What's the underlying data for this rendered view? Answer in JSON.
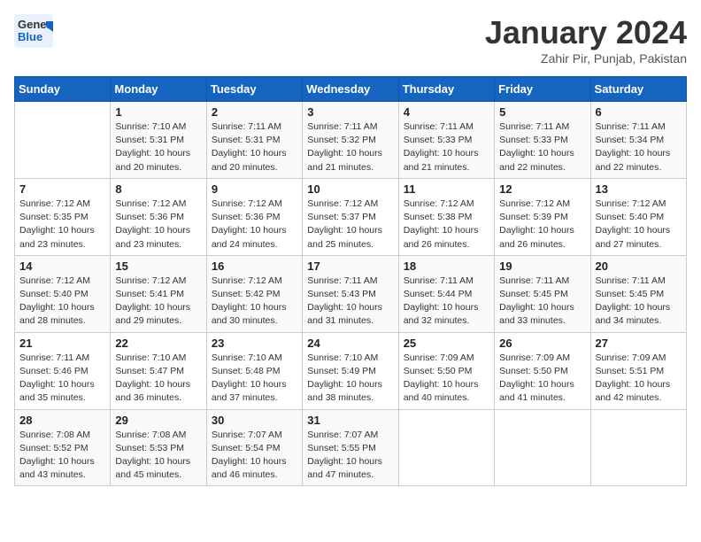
{
  "header": {
    "logo_general": "General",
    "logo_blue": "Blue",
    "title": "January 2024",
    "subtitle": "Zahir Pir, Punjab, Pakistan"
  },
  "days_of_week": [
    "Sunday",
    "Monday",
    "Tuesday",
    "Wednesday",
    "Thursday",
    "Friday",
    "Saturday"
  ],
  "weeks": [
    [
      {
        "day": "",
        "sunrise": "",
        "sunset": "",
        "daylight": ""
      },
      {
        "day": "1",
        "sunrise": "Sunrise: 7:10 AM",
        "sunset": "Sunset: 5:31 PM",
        "daylight": "Daylight: 10 hours and 20 minutes."
      },
      {
        "day": "2",
        "sunrise": "Sunrise: 7:11 AM",
        "sunset": "Sunset: 5:31 PM",
        "daylight": "Daylight: 10 hours and 20 minutes."
      },
      {
        "day": "3",
        "sunrise": "Sunrise: 7:11 AM",
        "sunset": "Sunset: 5:32 PM",
        "daylight": "Daylight: 10 hours and 21 minutes."
      },
      {
        "day": "4",
        "sunrise": "Sunrise: 7:11 AM",
        "sunset": "Sunset: 5:33 PM",
        "daylight": "Daylight: 10 hours and 21 minutes."
      },
      {
        "day": "5",
        "sunrise": "Sunrise: 7:11 AM",
        "sunset": "Sunset: 5:33 PM",
        "daylight": "Daylight: 10 hours and 22 minutes."
      },
      {
        "day": "6",
        "sunrise": "Sunrise: 7:11 AM",
        "sunset": "Sunset: 5:34 PM",
        "daylight": "Daylight: 10 hours and 22 minutes."
      }
    ],
    [
      {
        "day": "7",
        "sunrise": "Sunrise: 7:12 AM",
        "sunset": "Sunset: 5:35 PM",
        "daylight": "Daylight: 10 hours and 23 minutes."
      },
      {
        "day": "8",
        "sunrise": "Sunrise: 7:12 AM",
        "sunset": "Sunset: 5:36 PM",
        "daylight": "Daylight: 10 hours and 23 minutes."
      },
      {
        "day": "9",
        "sunrise": "Sunrise: 7:12 AM",
        "sunset": "Sunset: 5:36 PM",
        "daylight": "Daylight: 10 hours and 24 minutes."
      },
      {
        "day": "10",
        "sunrise": "Sunrise: 7:12 AM",
        "sunset": "Sunset: 5:37 PM",
        "daylight": "Daylight: 10 hours and 25 minutes."
      },
      {
        "day": "11",
        "sunrise": "Sunrise: 7:12 AM",
        "sunset": "Sunset: 5:38 PM",
        "daylight": "Daylight: 10 hours and 26 minutes."
      },
      {
        "day": "12",
        "sunrise": "Sunrise: 7:12 AM",
        "sunset": "Sunset: 5:39 PM",
        "daylight": "Daylight: 10 hours and 26 minutes."
      },
      {
        "day": "13",
        "sunrise": "Sunrise: 7:12 AM",
        "sunset": "Sunset: 5:40 PM",
        "daylight": "Daylight: 10 hours and 27 minutes."
      }
    ],
    [
      {
        "day": "14",
        "sunrise": "Sunrise: 7:12 AM",
        "sunset": "Sunset: 5:40 PM",
        "daylight": "Daylight: 10 hours and 28 minutes."
      },
      {
        "day": "15",
        "sunrise": "Sunrise: 7:12 AM",
        "sunset": "Sunset: 5:41 PM",
        "daylight": "Daylight: 10 hours and 29 minutes."
      },
      {
        "day": "16",
        "sunrise": "Sunrise: 7:12 AM",
        "sunset": "Sunset: 5:42 PM",
        "daylight": "Daylight: 10 hours and 30 minutes."
      },
      {
        "day": "17",
        "sunrise": "Sunrise: 7:11 AM",
        "sunset": "Sunset: 5:43 PM",
        "daylight": "Daylight: 10 hours and 31 minutes."
      },
      {
        "day": "18",
        "sunrise": "Sunrise: 7:11 AM",
        "sunset": "Sunset: 5:44 PM",
        "daylight": "Daylight: 10 hours and 32 minutes."
      },
      {
        "day": "19",
        "sunrise": "Sunrise: 7:11 AM",
        "sunset": "Sunset: 5:45 PM",
        "daylight": "Daylight: 10 hours and 33 minutes."
      },
      {
        "day": "20",
        "sunrise": "Sunrise: 7:11 AM",
        "sunset": "Sunset: 5:45 PM",
        "daylight": "Daylight: 10 hours and 34 minutes."
      }
    ],
    [
      {
        "day": "21",
        "sunrise": "Sunrise: 7:11 AM",
        "sunset": "Sunset: 5:46 PM",
        "daylight": "Daylight: 10 hours and 35 minutes."
      },
      {
        "day": "22",
        "sunrise": "Sunrise: 7:10 AM",
        "sunset": "Sunset: 5:47 PM",
        "daylight": "Daylight: 10 hours and 36 minutes."
      },
      {
        "day": "23",
        "sunrise": "Sunrise: 7:10 AM",
        "sunset": "Sunset: 5:48 PM",
        "daylight": "Daylight: 10 hours and 37 minutes."
      },
      {
        "day": "24",
        "sunrise": "Sunrise: 7:10 AM",
        "sunset": "Sunset: 5:49 PM",
        "daylight": "Daylight: 10 hours and 38 minutes."
      },
      {
        "day": "25",
        "sunrise": "Sunrise: 7:09 AM",
        "sunset": "Sunset: 5:50 PM",
        "daylight": "Daylight: 10 hours and 40 minutes."
      },
      {
        "day": "26",
        "sunrise": "Sunrise: 7:09 AM",
        "sunset": "Sunset: 5:50 PM",
        "daylight": "Daylight: 10 hours and 41 minutes."
      },
      {
        "day": "27",
        "sunrise": "Sunrise: 7:09 AM",
        "sunset": "Sunset: 5:51 PM",
        "daylight": "Daylight: 10 hours and 42 minutes."
      }
    ],
    [
      {
        "day": "28",
        "sunrise": "Sunrise: 7:08 AM",
        "sunset": "Sunset: 5:52 PM",
        "daylight": "Daylight: 10 hours and 43 minutes."
      },
      {
        "day": "29",
        "sunrise": "Sunrise: 7:08 AM",
        "sunset": "Sunset: 5:53 PM",
        "daylight": "Daylight: 10 hours and 45 minutes."
      },
      {
        "day": "30",
        "sunrise": "Sunrise: 7:07 AM",
        "sunset": "Sunset: 5:54 PM",
        "daylight": "Daylight: 10 hours and 46 minutes."
      },
      {
        "day": "31",
        "sunrise": "Sunrise: 7:07 AM",
        "sunset": "Sunset: 5:55 PM",
        "daylight": "Daylight: 10 hours and 47 minutes."
      },
      {
        "day": "",
        "sunrise": "",
        "sunset": "",
        "daylight": ""
      },
      {
        "day": "",
        "sunrise": "",
        "sunset": "",
        "daylight": ""
      },
      {
        "day": "",
        "sunrise": "",
        "sunset": "",
        "daylight": ""
      }
    ]
  ]
}
